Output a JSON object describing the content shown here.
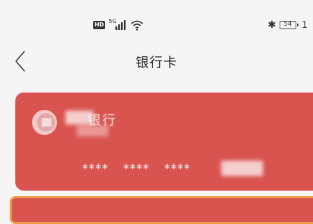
{
  "status_bar": {
    "hd_label": "HD",
    "network_label": "5G",
    "battery_level": "54",
    "time_partial": "1",
    "icons": [
      "hd-badge",
      "signal-icon",
      "wifi-icon",
      "bluetooth-icon",
      "battery-icon"
    ]
  },
  "nav": {
    "back_icon": "chevron-left-icon",
    "title": "银行卡"
  },
  "card": {
    "bank_name_visible": "银行",
    "number_groups": [
      "****",
      "****",
      "****"
    ],
    "colors": {
      "card": "#d9534f",
      "peek_border": "#f19a4a"
    }
  }
}
